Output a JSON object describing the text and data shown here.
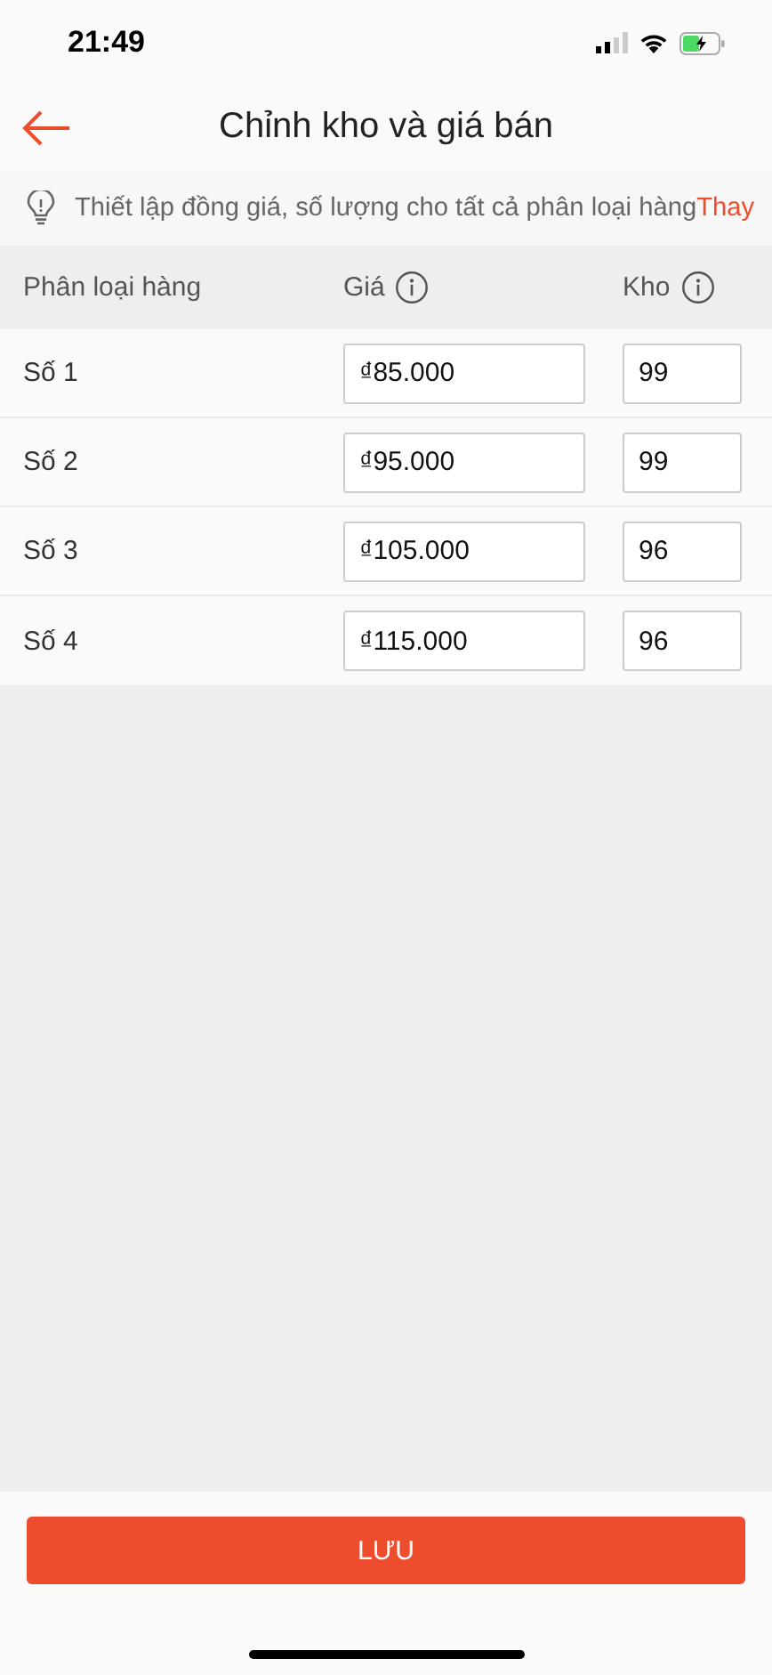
{
  "status_bar": {
    "time": "21:49"
  },
  "header": {
    "title": "Chỉnh kho và giá bán"
  },
  "tip": {
    "text": "Thiết lập đồng giá, số lượng cho tất cả phân loại hàng",
    "link": "Thay"
  },
  "table": {
    "columns": [
      {
        "label": "Phân loại hàng",
        "info": false
      },
      {
        "label": "Giá",
        "info": true
      },
      {
        "label": "Kho",
        "info": true
      }
    ],
    "rows": [
      {
        "name": "Số 1",
        "price": "₫85.000",
        "stock": "99"
      },
      {
        "name": "Số 2",
        "price": "₫95.000",
        "stock": "99"
      },
      {
        "name": "Số 3",
        "price": "₫105.000",
        "stock": "96"
      },
      {
        "name": "Số 4",
        "price": "₫115.000",
        "stock": "96"
      }
    ]
  },
  "save_button": {
    "label": "LƯU"
  }
}
